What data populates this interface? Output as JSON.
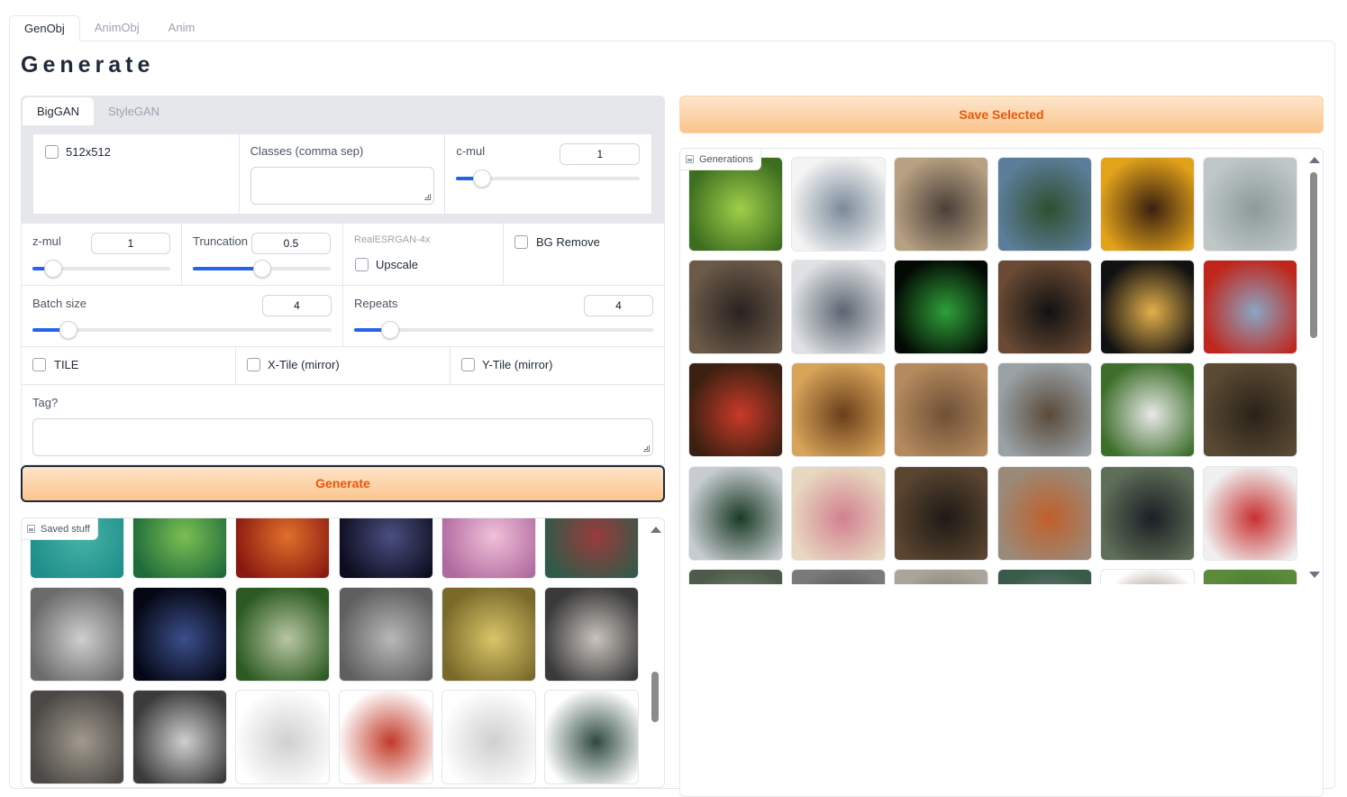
{
  "top_tabs": [
    "GenObj",
    "AnimObj",
    "Anim"
  ],
  "page_title": "Generate",
  "model_tabs": [
    "BigGAN",
    "StyleGAN"
  ],
  "biggan": {
    "res_label": "512x512",
    "classes_label": "Classes (comma sep)",
    "classes_value": "",
    "cmul_label": "c-mul",
    "cmul_value": "1"
  },
  "zmul": {
    "label": "z-mul",
    "value": "1"
  },
  "truncation": {
    "label": "Truncation",
    "value": "0.5"
  },
  "upscale": {
    "caption": "RealESRGAN-4x",
    "label": "Upscale"
  },
  "bg_remove": {
    "label": "BG Remove"
  },
  "batch": {
    "label": "Batch size",
    "value": "4"
  },
  "repeats": {
    "label": "Repeats",
    "value": "4"
  },
  "tiles": {
    "tile": "TILE",
    "xtile": "X-Tile (mirror)",
    "ytile": "Y-Tile (mirror)"
  },
  "tag": {
    "label": "Tag?",
    "value": ""
  },
  "generate_label": "Generate",
  "save_label": "Save Selected",
  "saved_label": "Saved stuff",
  "generations_label": "Generations",
  "saved_thumbs": [
    {
      "subject": "teal texture",
      "colors": [
        "#1f8f8a",
        "#47b3a6"
      ]
    },
    {
      "subject": "green moss texture",
      "colors": [
        "#1e6b3a",
        "#7bbf53"
      ]
    },
    {
      "subject": "red and orange texture",
      "colors": [
        "#8a1a10",
        "#e0702a"
      ]
    },
    {
      "subject": "dark blue tangle",
      "colors": [
        "#0d0d1f",
        "#4a4f80"
      ]
    },
    {
      "subject": "pink baubles",
      "colors": [
        "#b06aa0",
        "#f0c0d8"
      ]
    },
    {
      "subject": "green scales",
      "colors": [
        "#2f5a4a",
        "#9a3b3b"
      ]
    },
    {
      "subject": "grey carved pattern",
      "colors": [
        "#6b6b6b",
        "#cfcfcf"
      ]
    },
    {
      "subject": "dark blue lines",
      "colors": [
        "#050814",
        "#3c4e8c"
      ]
    },
    {
      "subject": "green leafy mass",
      "colors": [
        "#2c5a22",
        "#b9c7a2"
      ]
    },
    {
      "subject": "grey concrete",
      "colors": [
        "#5f5f5f",
        "#b8b8b8"
      ]
    },
    {
      "subject": "gold pattern",
      "colors": [
        "#7a6a2a",
        "#d8c56a"
      ]
    },
    {
      "subject": "metal shards",
      "colors": [
        "#3a3a3a",
        "#c9c3bd"
      ]
    },
    {
      "subject": "grey stone relief",
      "colors": [
        "#4b4845",
        "#a19a8e"
      ]
    },
    {
      "subject": "grey metal lines",
      "colors": [
        "#3b3b3b",
        "#cfcfcf"
      ]
    },
    {
      "subject": "white van",
      "colors": [
        "#ffffff",
        "#d0d0d0"
      ]
    },
    {
      "subject": "red white truck",
      "colors": [
        "#ffffff",
        "#c23a2a"
      ]
    },
    {
      "subject": "white car",
      "colors": [
        "#ffffff",
        "#cfcfcf"
      ]
    },
    {
      "subject": "dark green suv",
      "colors": [
        "#ffffff",
        "#2f4a40"
      ]
    }
  ],
  "generation_thumbs": [
    {
      "subject": "guacamole bowl",
      "colors": [
        "#3d6e1f",
        "#9fcf4a"
      ]
    },
    {
      "subject": "handheld device",
      "colors": [
        "#f4f4f4",
        "#7a8a9a"
      ]
    },
    {
      "subject": "breastplate",
      "colors": [
        "#b8a183",
        "#4a4038"
      ]
    },
    {
      "subject": "convertible car",
      "colors": [
        "#5c7e9a",
        "#2f4f2f"
      ]
    },
    {
      "subject": "stuffed squash",
      "colors": [
        "#e2a21a",
        "#3a2010"
      ]
    },
    {
      "subject": "teapot",
      "colors": [
        "#bfc8c6",
        "#8c9a9a"
      ]
    },
    {
      "subject": "pug",
      "colors": [
        "#6b5a48",
        "#2a2220"
      ]
    },
    {
      "subject": "limousine",
      "colors": [
        "#dfe1e4",
        "#5b6570"
      ]
    },
    {
      "subject": "green glow",
      "colors": [
        "#030a04",
        "#2fa03a"
      ]
    },
    {
      "subject": "black robe",
      "colors": [
        "#6a4a34",
        "#111111"
      ]
    },
    {
      "subject": "costumed figure",
      "colors": [
        "#111111",
        "#e3b04a"
      ]
    },
    {
      "subject": "fire truck",
      "colors": [
        "#c0261c",
        "#8aa6c4"
      ]
    },
    {
      "subject": "person red hair",
      "colors": [
        "#3a2010",
        "#c93a2a"
      ]
    },
    {
      "subject": "potatoes",
      "colors": [
        "#d7a45a",
        "#6a3f1a"
      ]
    },
    {
      "subject": "snake on sand",
      "colors": [
        "#b58a5e",
        "#6e5036"
      ]
    },
    {
      "subject": "sled outdoors",
      "colors": [
        "#9aa2a6",
        "#5a4a3a"
      ]
    },
    {
      "subject": "football player",
      "colors": [
        "#3d6e2a",
        "#e9e9e9"
      ]
    },
    {
      "subject": "safe",
      "colors": [
        "#5a4a34",
        "#2a2218"
      ]
    },
    {
      "subject": "trash can",
      "colors": [
        "#c7ccd0",
        "#1a3a24"
      ]
    },
    {
      "subject": "lotion bottle",
      "colors": [
        "#e8d8c0",
        "#d28090"
      ]
    },
    {
      "subject": "german shepherd",
      "colors": [
        "#5a4530",
        "#1e1a16"
      ]
    },
    {
      "subject": "hermit crab",
      "colors": [
        "#9a8a7a",
        "#c0602a"
      ]
    },
    {
      "subject": "parking meter",
      "colors": [
        "#5f6e58",
        "#1b1f24"
      ]
    },
    {
      "subject": "plastic bag",
      "colors": [
        "#f0f0f0",
        "#c83030"
      ]
    },
    {
      "subject": "partial 1",
      "colors": [
        "#4d5b4a",
        "#8a9a8a"
      ]
    },
    {
      "subject": "partial 2",
      "colors": [
        "#7a7a7a",
        "#3a3a3a"
      ]
    },
    {
      "subject": "partial 3",
      "colors": [
        "#aaa59a",
        "#6a6458"
      ]
    },
    {
      "subject": "partial 4",
      "colors": [
        "#3a5a4a",
        "#7a8a8a"
      ]
    },
    {
      "subject": "partial 5",
      "colors": [
        "#ffffff",
        "#6a4a3a"
      ]
    },
    {
      "subject": "partial 6",
      "colors": [
        "#5a8a3a",
        "#3a6a2a"
      ]
    }
  ]
}
